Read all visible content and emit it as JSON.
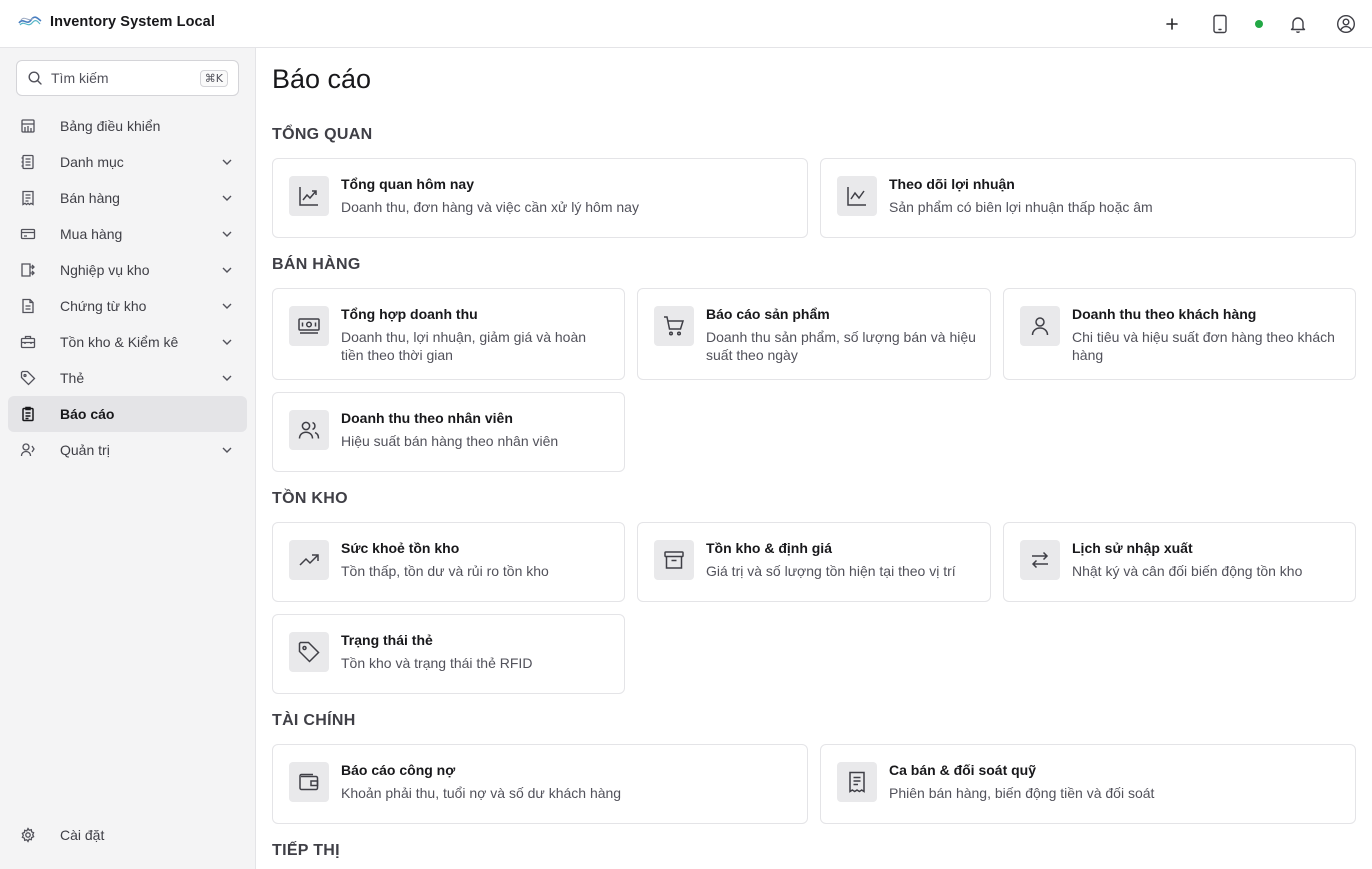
{
  "app": {
    "title": "Inventory System Local"
  },
  "topbar": {
    "icons": [
      "plus-icon",
      "tablet-icon",
      "status-dot",
      "bell-icon",
      "user-circle-icon"
    ]
  },
  "sidebar": {
    "search_placeholder": "Tìm kiếm",
    "search_shortcut": "⌘K",
    "items": [
      {
        "label": "Bảng điều khiển",
        "icon": "dashboard-icon"
      },
      {
        "label": "Danh mục",
        "icon": "catalog-icon"
      },
      {
        "label": "Bán hàng",
        "icon": "receipt-icon"
      },
      {
        "label": "Mua hàng",
        "icon": "credit-card-icon"
      },
      {
        "label": "Nghiệp vụ kho",
        "icon": "warehouse-ops-icon"
      },
      {
        "label": "Chứng từ kho",
        "icon": "file-icon"
      },
      {
        "label": "Tồn kho & Kiểm kê",
        "icon": "briefcase-icon"
      },
      {
        "label": "Thẻ",
        "icon": "tag-icon"
      },
      {
        "label": "Báo cáo",
        "icon": "clipboard-icon",
        "active": true
      },
      {
        "label": "Quản trị",
        "icon": "admin-icon"
      }
    ],
    "settings_label": "Cài đặt"
  },
  "main": {
    "title": "Báo cáo",
    "sections": [
      {
        "title": "TỔNG QUAN",
        "cards": [
          {
            "title": "Tổng quan hôm nay",
            "desc": "Doanh thu, đơn hàng và việc cần xử lý hôm nay",
            "icon": "trend-chart-icon"
          },
          {
            "title": "Theo dõi lợi nhuận",
            "desc": "Sản phẩm có biên lợi nhuận thấp hoặc âm",
            "icon": "line-chart-icon"
          }
        ]
      },
      {
        "title": "BÁN HÀNG",
        "cards": [
          {
            "title": "Tổng hợp doanh thu",
            "desc": "Doanh thu, lợi nhuận, giảm giá và hoàn tiền theo thời gian",
            "icon": "banknote-icon"
          },
          {
            "title": "Báo cáo sản phẩm",
            "desc": "Doanh thu sản phẩm, số lượng bán và hiệu suất theo ngày",
            "icon": "cart-icon"
          },
          {
            "title": "Doanh thu theo khách hàng",
            "desc": "Chi tiêu và hiệu suất đơn hàng theo khách hàng",
            "icon": "user-icon"
          },
          {
            "title": "Doanh thu theo nhân viên",
            "desc": "Hiệu suất bán hàng theo nhân viên",
            "icon": "users-icon"
          }
        ]
      },
      {
        "title": "TỒN KHO",
        "cards": [
          {
            "title": "Sức khoẻ tồn kho",
            "desc": "Tồn thấp, tồn dư và rủi ro tồn kho",
            "icon": "trending-up-icon"
          },
          {
            "title": "Tồn kho & định giá",
            "desc": "Giá trị và số lượng tồn hiện tại theo vị trí",
            "icon": "archive-icon"
          },
          {
            "title": "Lịch sử nhập xuất",
            "desc": "Nhật ký và cân đối biến động tồn kho",
            "icon": "arrows-swap-icon"
          },
          {
            "title": "Trạng thái thẻ",
            "desc": "Tồn kho và trạng thái thẻ RFID",
            "icon": "tag-icon"
          }
        ]
      },
      {
        "title": "TÀI CHÍNH",
        "cards": [
          {
            "title": "Báo cáo công nợ",
            "desc": "Khoản phải thu, tuổi nợ và số dư khách hàng",
            "icon": "wallet-icon"
          },
          {
            "title": "Ca bán & đối soát quỹ",
            "desc": "Phiên bán hàng, biến động tiền và đối soát",
            "icon": "receipt-icon"
          }
        ]
      },
      {
        "title": "TIẾP THỊ",
        "cards": []
      }
    ]
  }
}
